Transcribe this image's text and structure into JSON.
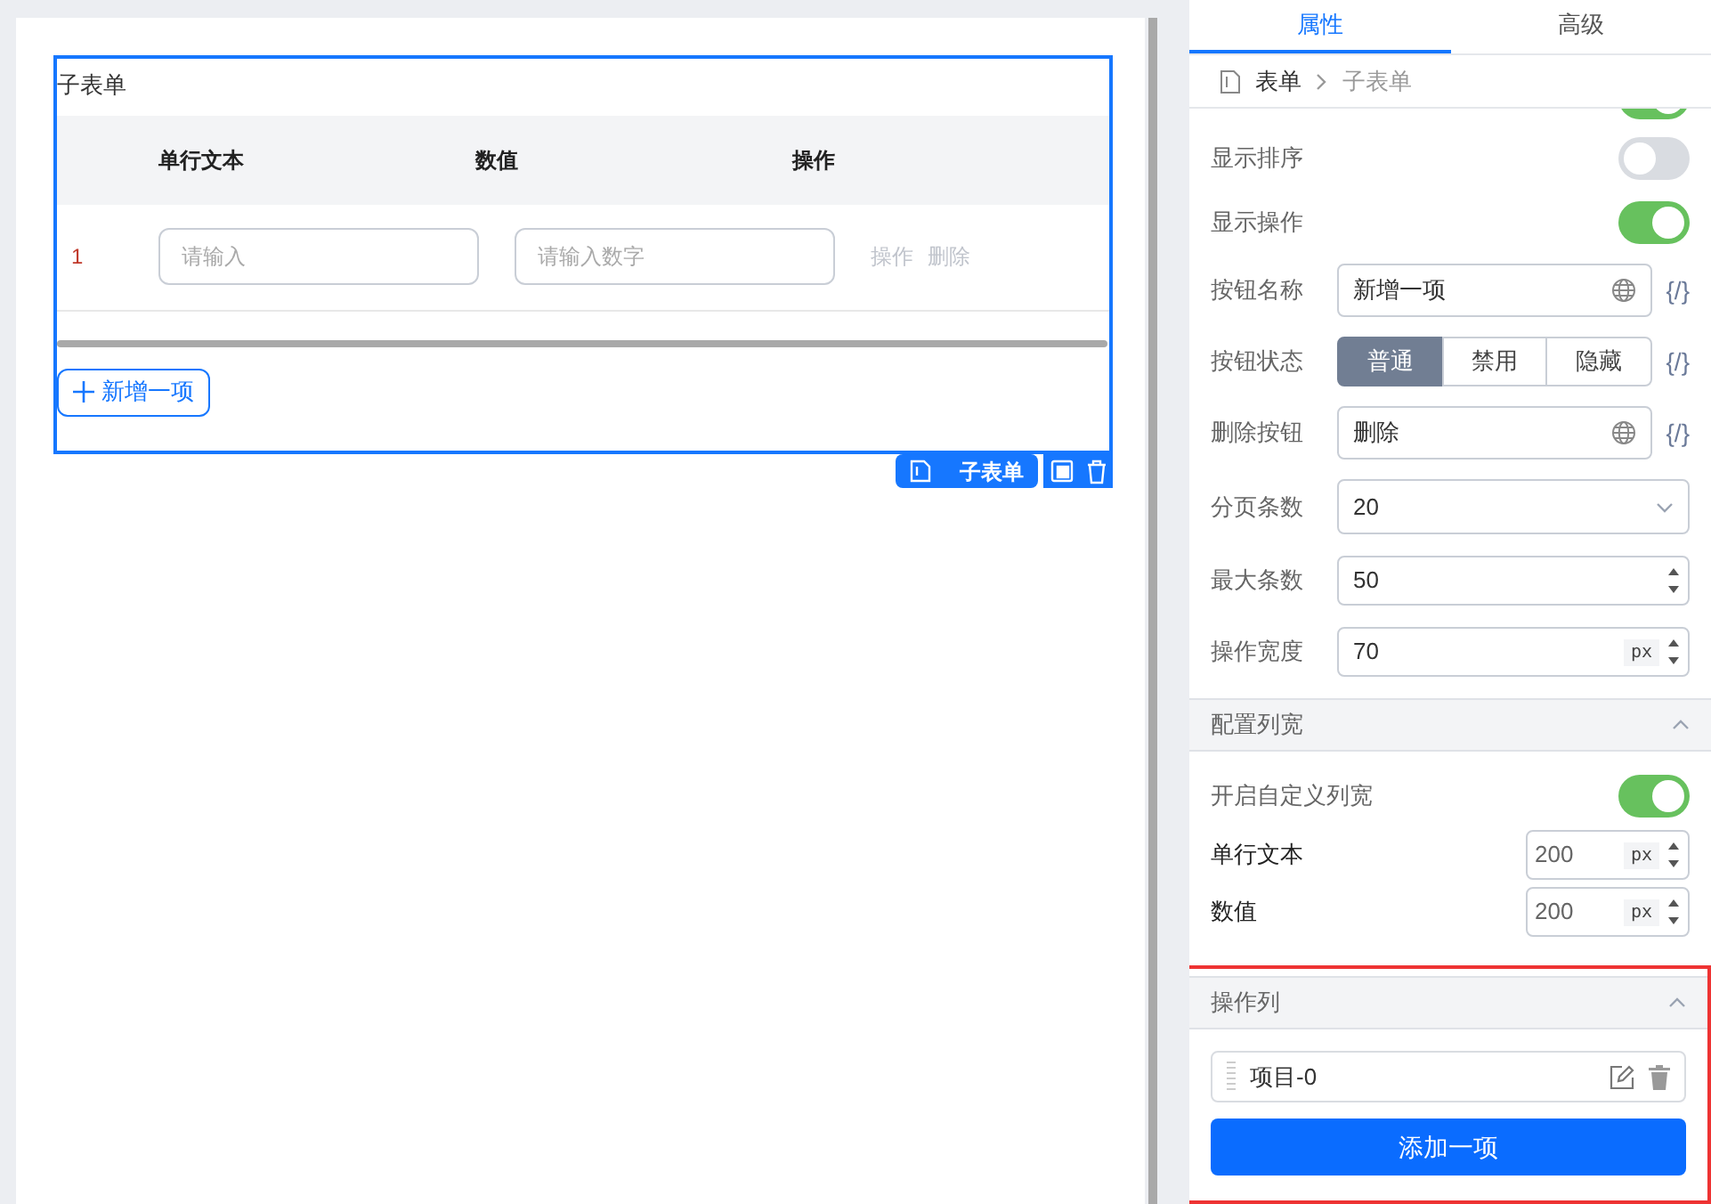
{
  "canvas": {
    "form_title": "子表单",
    "table": {
      "columns": [
        "单行文本",
        "数值",
        "操作"
      ],
      "rows": [
        {
          "index": "1",
          "text_placeholder": "请输入",
          "number_placeholder": "请输入数字",
          "actions": [
            "操作",
            "删除"
          ]
        }
      ]
    },
    "add_button": "新增一项",
    "toolbar_label": "子表单"
  },
  "panel": {
    "tabs": [
      {
        "label": "属性",
        "selected": true
      },
      {
        "label": "高级",
        "selected": false
      }
    ],
    "breadcrumb": [
      "表单",
      "子表单"
    ],
    "rows": [
      {
        "kind": "toggle",
        "on": true
      },
      {
        "kind": "toggle",
        "label": "显示排序",
        "on": false
      },
      {
        "kind": "toggle",
        "label": "显示操作",
        "on": true
      },
      {
        "kind": "text",
        "label": "按钮名称",
        "value": "新增一项",
        "expr": "{/}"
      },
      {
        "kind": "segmented",
        "label": "按钮状态",
        "options": [
          {
            "label": "普通",
            "selected": true
          },
          {
            "label": "禁用",
            "selected": false
          },
          {
            "label": "隐藏",
            "selected": false
          }
        ],
        "expr": "{/}"
      },
      {
        "kind": "text",
        "label": "删除按钮",
        "value": "删除",
        "expr": "{/}"
      },
      {
        "kind": "select",
        "label": "分页条数",
        "value": "20"
      },
      {
        "kind": "number",
        "label": "最大条数",
        "value": "50"
      },
      {
        "kind": "number",
        "label": "操作宽度",
        "value": "70",
        "unit": "px"
      }
    ],
    "width_section": {
      "title": "配置列宽",
      "expanded": true,
      "toggle": {
        "label": "开启自定义列宽",
        "on": true
      },
      "columns": [
        {
          "label": "单行文本",
          "value": "200",
          "unit": "px"
        },
        {
          "label": "数值",
          "value": "200",
          "unit": "px"
        }
      ]
    },
    "action_section": {
      "title": "操作列",
      "expanded": true,
      "highlighted": true,
      "items": [
        "项目-0"
      ],
      "add_button": "添加一项"
    }
  }
}
